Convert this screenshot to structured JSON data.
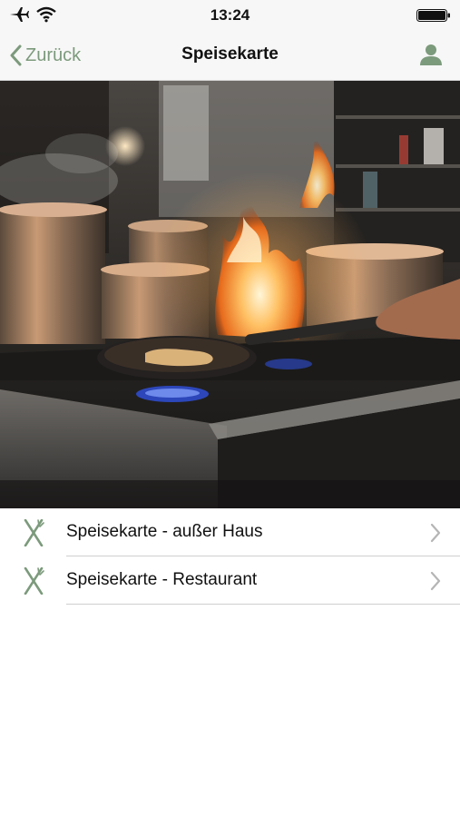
{
  "status_bar": {
    "time": "13:24",
    "left_icons": [
      "airplane-icon",
      "wifi-icon"
    ],
    "right_icons": [
      "battery-icon"
    ]
  },
  "nav": {
    "back_label": "Zurück",
    "title": "Speisekarte",
    "right_icon": "profile-icon"
  },
  "hero": {
    "image_subject": "kitchen-stove-flames-image"
  },
  "menu": {
    "items": [
      {
        "label": "Speisekarte - außer Haus",
        "icon": "cutlery-icon"
      },
      {
        "label": "Speisekarte - Restaurant",
        "icon": "cutlery-icon"
      }
    ]
  },
  "colors": {
    "accent": "#7c9a7c",
    "bar_background": "#f7f7f7",
    "separator": "#cfcfcf"
  }
}
